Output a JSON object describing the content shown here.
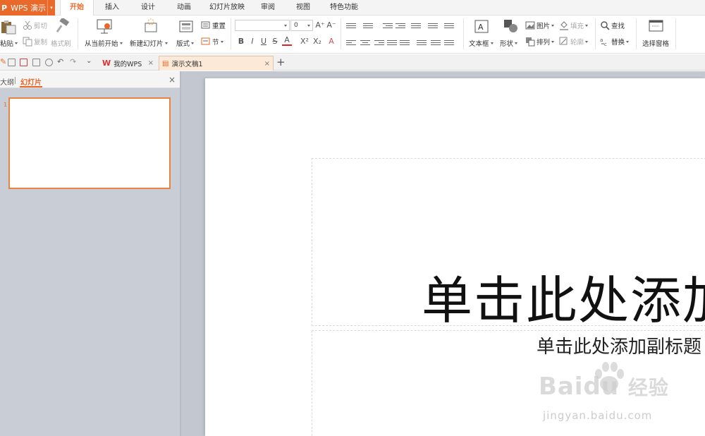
{
  "app": {
    "name": "WPS 演示",
    "logo_letter": "P"
  },
  "menu_tabs": [
    {
      "label": "开始",
      "active": true
    },
    {
      "label": "插入"
    },
    {
      "label": "设计"
    },
    {
      "label": "动画"
    },
    {
      "label": "幻灯片放映"
    },
    {
      "label": "审阅"
    },
    {
      "label": "视图"
    },
    {
      "label": "特色功能"
    }
  ],
  "ribbon": {
    "clipboard": {
      "paste": "粘贴",
      "cut": "剪切",
      "copy": "复制",
      "format_painter": "格式刷"
    },
    "slides": {
      "from_current": "从当前开始",
      "new_slide": "新建幻灯片",
      "layout": "版式",
      "reset": "重置",
      "section": "节"
    },
    "font": {
      "name_value": "",
      "size_value": "0",
      "bold": "B",
      "italic": "I",
      "underline": "U",
      "strike": "S",
      "color": "A",
      "superscript": "X²",
      "subscript": "X₂",
      "grow": "A⁺",
      "shrink": "A⁻",
      "clear": "A"
    },
    "drawing": {
      "textbox": "文本框",
      "shape": "形状",
      "picture": "图片",
      "fill": "填充",
      "arrange": "排列",
      "outline": "轮廓"
    },
    "editing": {
      "find": "查找",
      "replace": "替换",
      "select_pane": "选择窗格"
    }
  },
  "doc_tabs": [
    {
      "label": "我的WPS",
      "active": false
    },
    {
      "label": "演示文稿1",
      "active": true
    }
  ],
  "left_panel": {
    "tab_outline": "大纲",
    "tab_slides": "幻灯片",
    "slide_numbers": [
      "1"
    ]
  },
  "slide": {
    "title_placeholder": "单击此处添加标题",
    "subtitle_placeholder": "单击此处添加副标题"
  },
  "watermark": {
    "brand": "Baidu",
    "brand_cn": "经验",
    "url": "jingyan.baidu.com"
  },
  "colors": {
    "accent": "#e8692a",
    "panel_bg": "#c9cdd6",
    "thumb_border": "#e8843f"
  }
}
